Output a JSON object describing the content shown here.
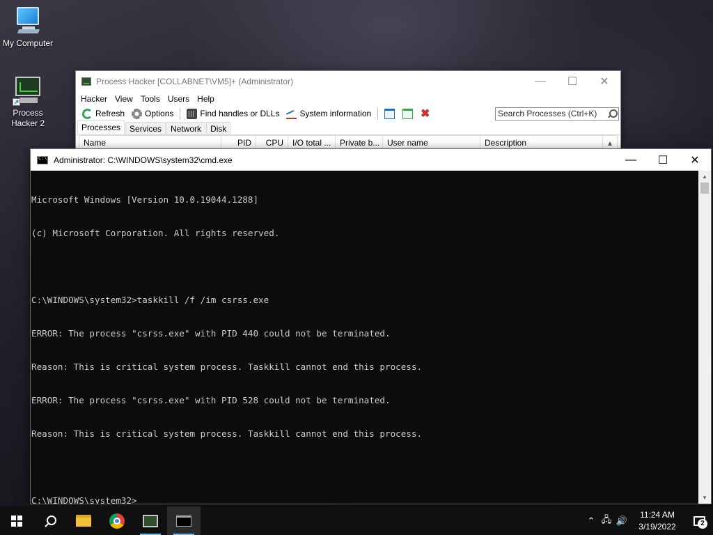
{
  "desktop": {
    "icons": [
      {
        "label": "My Computer",
        "icon": "computer-icon"
      },
      {
        "label": "Process\nHacker 2",
        "icon": "process-hacker-icon"
      }
    ]
  },
  "process_hacker": {
    "title": "Process Hacker [COLLABNET\\VM5]+ (Administrator)",
    "menu": [
      "Hacker",
      "View",
      "Tools",
      "Users",
      "Help"
    ],
    "toolbar": {
      "refresh_label": "Refresh",
      "options_label": "Options",
      "find_handles_label": "Find handles or DLLs",
      "system_info_label": "System information"
    },
    "search": {
      "placeholder": "Search Processes (Ctrl+K)"
    },
    "tabs": [
      "Processes",
      "Services",
      "Network",
      "Disk"
    ],
    "columns": [
      "Name",
      "PID",
      "CPU",
      "I/O total ...",
      "Private b...",
      "User name",
      "Description"
    ]
  },
  "cmd": {
    "title": "Administrator: C:\\WINDOWS\\system32\\cmd.exe",
    "lines": [
      "Microsoft Windows [Version 10.0.19044.1288]",
      "(c) Microsoft Corporation. All rights reserved.",
      "",
      "C:\\WINDOWS\\system32>taskkill /f /im csrss.exe",
      "ERROR: The process \"csrss.exe\" with PID 440 could not be terminated.",
      "Reason: This is critical system process. Taskkill cannot end this process.",
      "ERROR: The process \"csrss.exe\" with PID 528 could not be terminated.",
      "Reason: This is critical system process. Taskkill cannot end this process.",
      "",
      "C:\\WINDOWS\\system32>"
    ]
  },
  "taskbar": {
    "time": "11:24 AM",
    "date": "3/19/2022",
    "notification_count": "2",
    "apps": [
      "start-icon",
      "search-icon",
      "file-explorer-icon",
      "chrome-icon",
      "process-hacker-icon",
      "cmd-icon"
    ]
  }
}
